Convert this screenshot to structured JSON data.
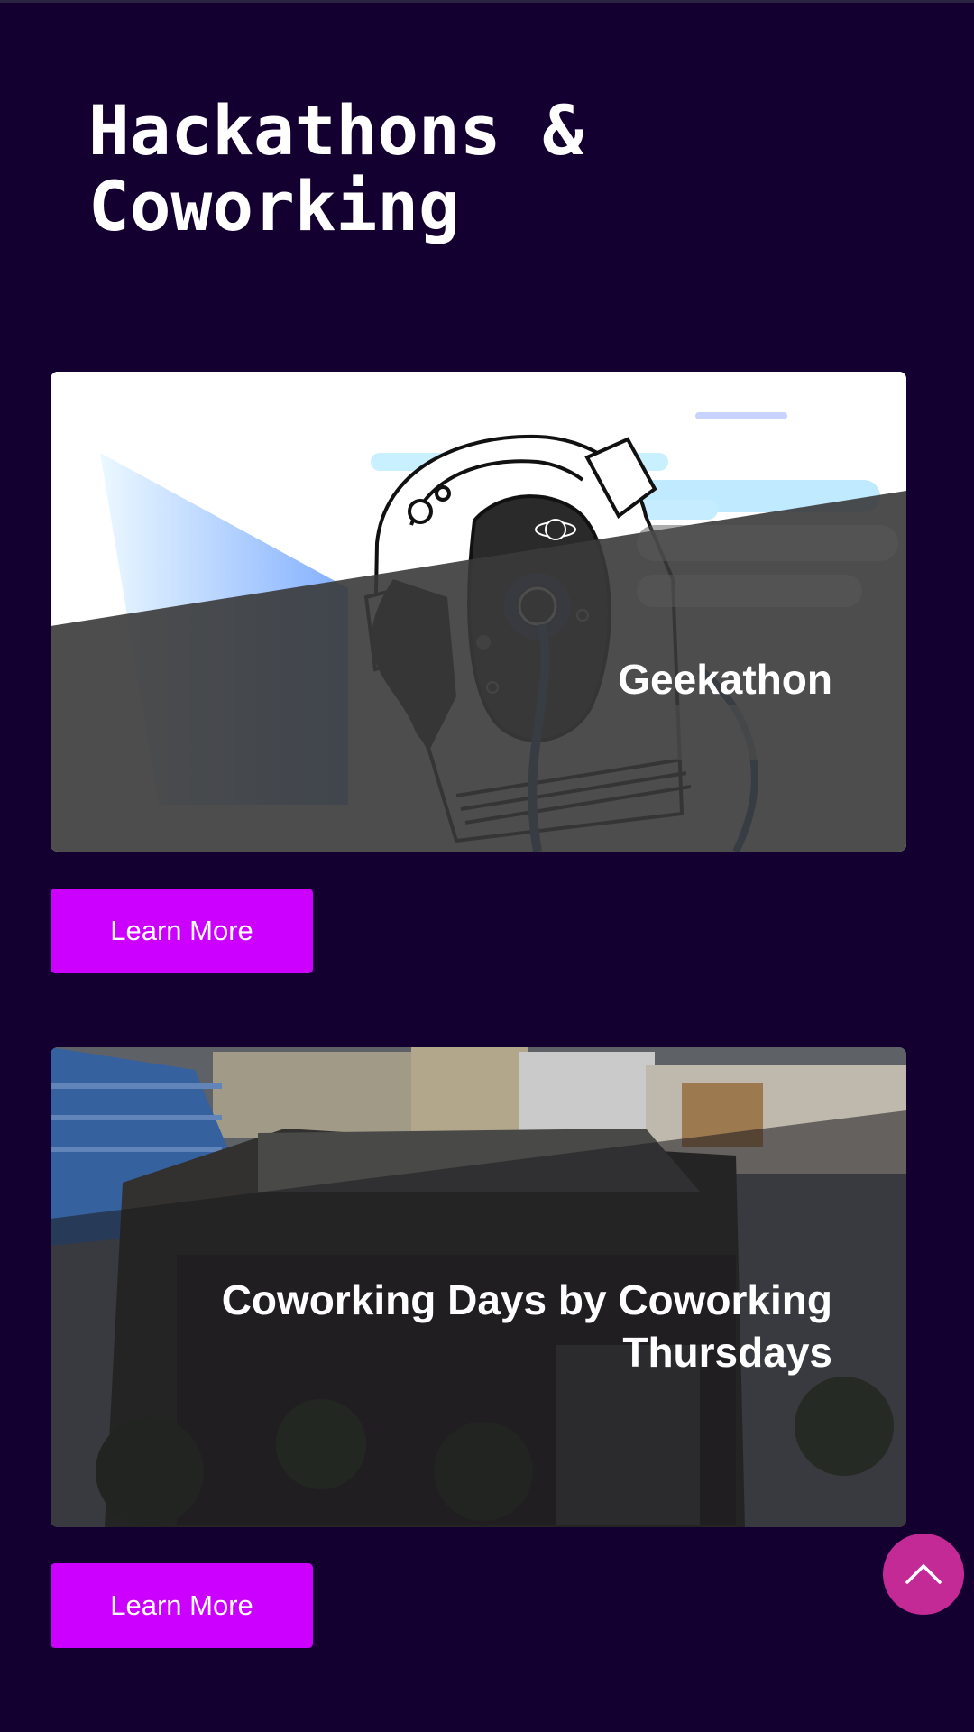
{
  "page": {
    "title": "Hackathons & Coworking"
  },
  "cards": [
    {
      "title": "Geekathon",
      "button_label": "Learn More"
    },
    {
      "title": "Coworking Days by Coworking Thursdays",
      "button_label": "Learn More"
    }
  ],
  "colors": {
    "background": "#140030",
    "button": "#cc00ff",
    "scroll_top_button": "#c42a96"
  },
  "icons": {
    "scroll_top": "chevron-up-icon"
  }
}
